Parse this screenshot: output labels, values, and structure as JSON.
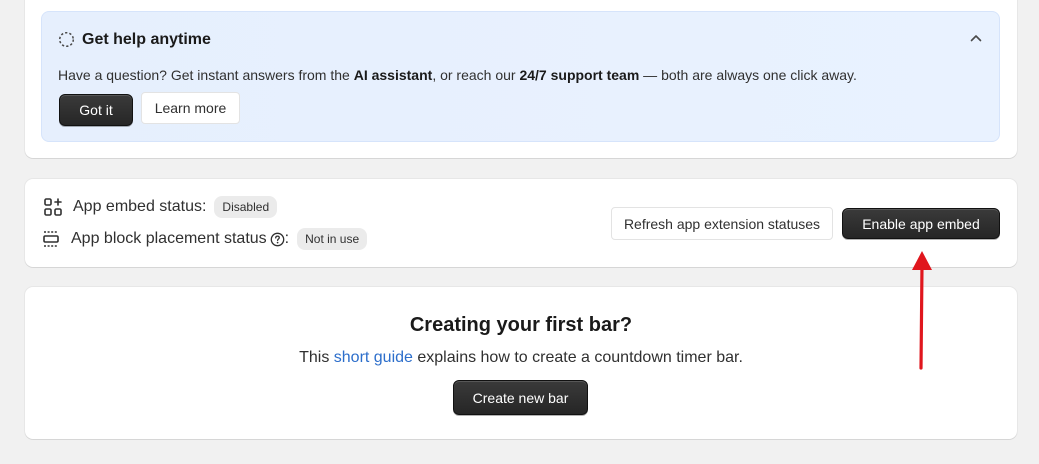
{
  "banner": {
    "title": "Get help anytime",
    "text_1": "Have a question? Get instant answers from the ",
    "text_bold_1": "AI assistant",
    "text_2": ", or reach our ",
    "text_bold_2": "24/7 support team",
    "text_3": " — both are always one click away.",
    "got_it_label": "Got it",
    "learn_more_label": "Learn more",
    "icon": "dashed-circle-icon",
    "collapse_icon": "chevron-up-icon",
    "background": "#e8f0fe"
  },
  "status": {
    "embed_label": "App embed status:",
    "embed_badge": "Disabled",
    "embed_icon": "apps-add-icon",
    "block_label": "App block placement status",
    "block_suffix": ":",
    "block_badge": "Not in use",
    "block_icon": "layout-block-icon",
    "help_icon": "question-circle-icon",
    "refresh_label": "Refresh app extension statuses",
    "enable_label": "Enable app embed"
  },
  "bottom": {
    "title": "Creating your first bar?",
    "text_before": "This ",
    "link_text": "short guide",
    "text_after": " explains how to create a countdown timer bar.",
    "create_label": "Create new bar",
    "link_color": "#2c6ecb"
  },
  "annotation": {
    "arrow_color": "#e0161d"
  }
}
